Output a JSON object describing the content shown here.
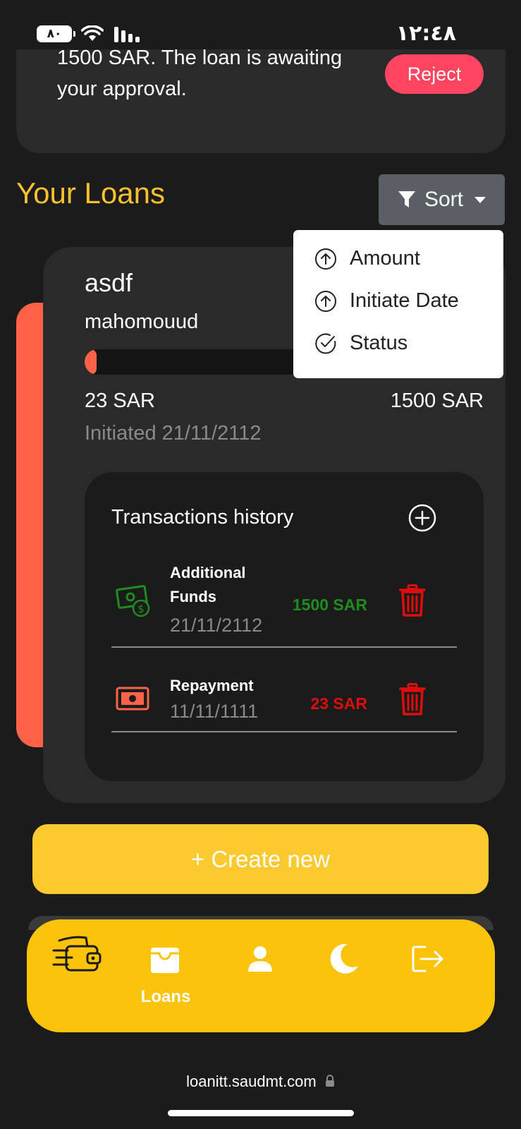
{
  "status_bar": {
    "battery": "٨٠",
    "time": "١٢:٤٨"
  },
  "request": {
    "text_line1": "1500 SAR. The loan is awaiting",
    "text_line2": "your approval.",
    "reject_label": "Reject"
  },
  "section": {
    "title": "Your Loans",
    "sort_label": "Sort"
  },
  "sort_menu": {
    "items": [
      {
        "label": "Amount",
        "icon": "arrow-up-circle-icon"
      },
      {
        "label": "Initiate Date",
        "icon": "arrow-up-circle-icon"
      },
      {
        "label": "Status",
        "icon": "check-circle-icon"
      }
    ]
  },
  "loan": {
    "name": "asdf",
    "user": "mahomouud",
    "progress_fraction": 0.015,
    "paid": "23 SAR",
    "total": "1500 SAR",
    "initiated": "Initiated 21/11/2112",
    "accent_color": "#ff6248",
    "transactions_title": "Transactions history",
    "transactions": [
      {
        "title_line1": "Additional",
        "title_line2": "Funds",
        "date": "21/11/2112",
        "amount": "1500 SAR",
        "color": "#1f8c1f",
        "icon": "money-dollar-icon"
      },
      {
        "title_line1": "Repayment",
        "title_line2": "",
        "date": "11/11/1111",
        "amount": "23 SAR",
        "color": "#e00d0d",
        "icon": "banknote-icon"
      }
    ]
  },
  "create_new_label": "+ Create new",
  "nav": {
    "loans_label": "Loans"
  },
  "browser": {
    "url": "loanitt.saudmt.com"
  }
}
